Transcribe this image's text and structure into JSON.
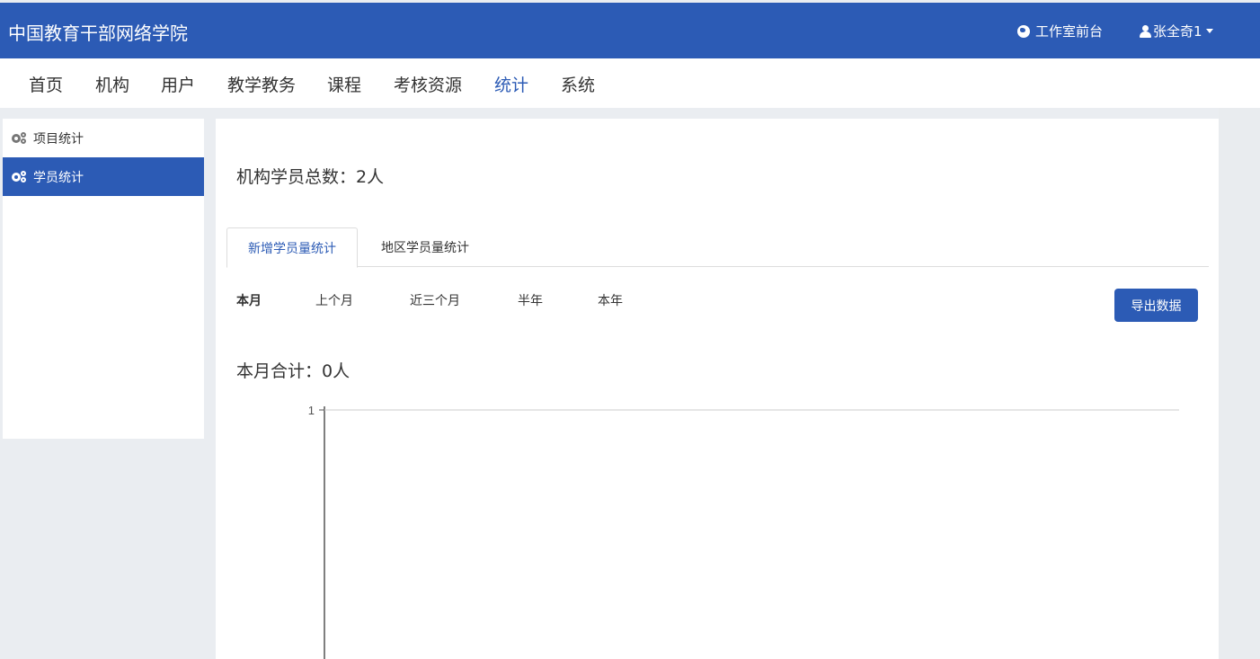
{
  "header": {
    "brand": "中国教育干部网络学院",
    "frontdesk_label": "工作室前台",
    "user_label": "张全奇1"
  },
  "nav": {
    "items": [
      {
        "label": "首页"
      },
      {
        "label": "机构"
      },
      {
        "label": "用户"
      },
      {
        "label": "教学教务"
      },
      {
        "label": "课程"
      },
      {
        "label": "考核资源"
      },
      {
        "label": "统计",
        "active": true
      },
      {
        "label": "系统"
      }
    ]
  },
  "sidebar": {
    "items": [
      {
        "label": "项目统计",
        "icon": "gears-icon"
      },
      {
        "label": "学员统计",
        "icon": "gears-icon",
        "active": true
      }
    ]
  },
  "main": {
    "total_text": "机构学员总数：2人",
    "tabs": [
      {
        "label": "新增学员量统计",
        "active": true
      },
      {
        "label": "地区学员量统计"
      }
    ],
    "periods": [
      {
        "label": "本月",
        "active": true
      },
      {
        "label": "上个月"
      },
      {
        "label": "近三个月"
      },
      {
        "label": "半年"
      },
      {
        "label": "本年"
      }
    ],
    "export_label": "导出数据",
    "month_total_text": "本月合计：0人"
  },
  "chart_data": {
    "type": "line",
    "x": [],
    "series": [],
    "title": "",
    "xlabel": "",
    "ylabel": "",
    "yticks": [
      "1"
    ],
    "ylim": [
      0,
      1
    ],
    "grid": true
  },
  "colors": {
    "brand_blue": "#2c5bb5",
    "page_bg": "#eaedf1"
  }
}
